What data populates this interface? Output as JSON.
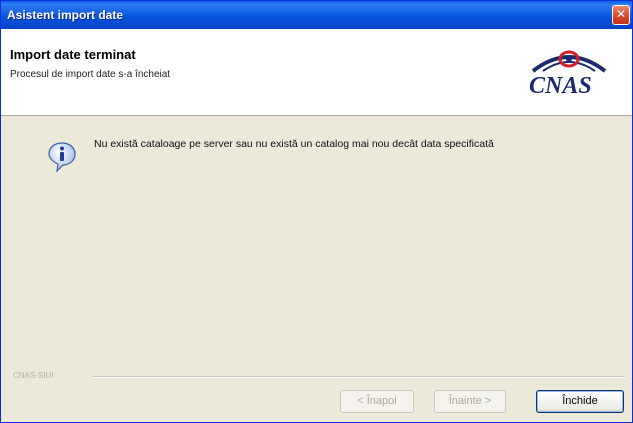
{
  "window": {
    "title": "Asistent import date",
    "close_glyph": "✕"
  },
  "header": {
    "title": "Import date terminat",
    "subtitle": "Procesul de import date s-a încheiat"
  },
  "logo": {
    "text": "CNAS",
    "icon": "cnas-eye-logo"
  },
  "message": {
    "icon": "info-icon",
    "text": "Nu există cataloage pe server sau nu există un catalog mai nou decât data specificată"
  },
  "footer": {
    "brand": "CNAS-SIUI",
    "buttons": {
      "back_label": "< Înapoi",
      "next_label": "Înainte >",
      "close_label": "Închide"
    }
  },
  "colors": {
    "titlebar": "#0a55de",
    "dialog_background": "#ece9d8",
    "logo_red": "#d62027",
    "logo_blue": "#1d2a6e"
  }
}
